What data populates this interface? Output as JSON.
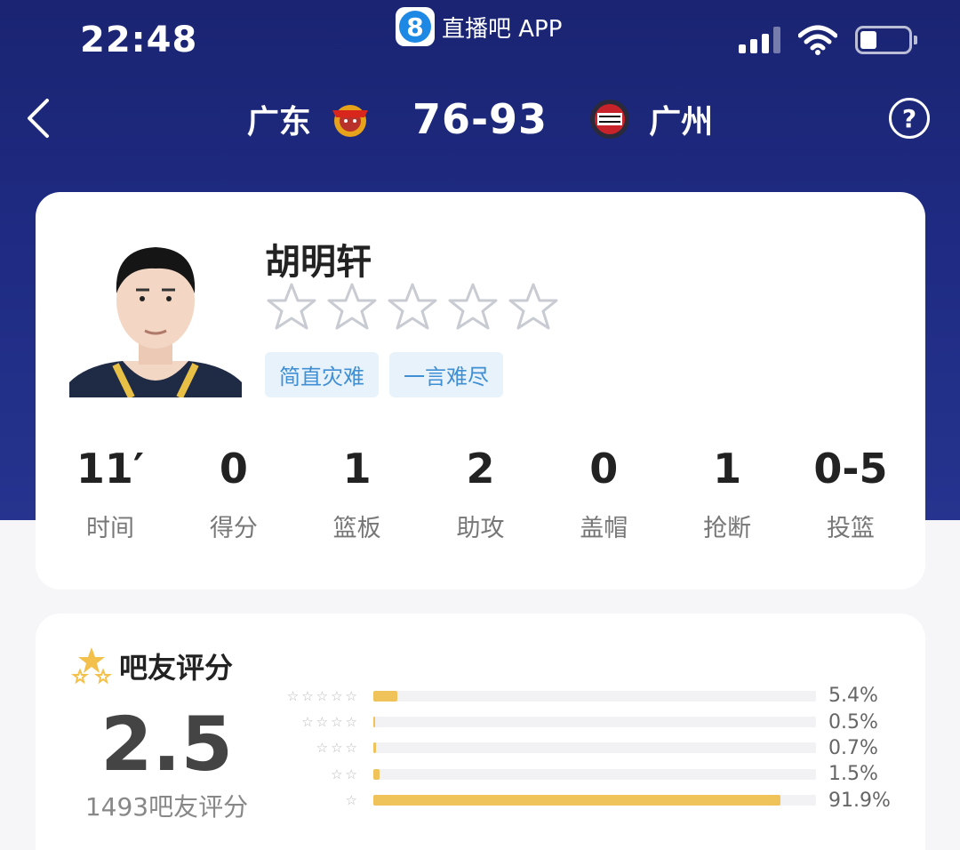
{
  "status_bar": {
    "time": "22:48",
    "app_logo_char": "8",
    "app_name": "直播吧 APP",
    "signal_icon": "signal-icon",
    "wifi_icon": "wifi-icon",
    "battery_icon": "battery-icon",
    "battery_level": 0.35
  },
  "match": {
    "home_team": "广东",
    "home_logo": "guangdong-tigers-logo",
    "score": "76-93",
    "away_team": "广州",
    "away_logo": "guangzhou-loong-lions-logo",
    "back_icon": "chevron-left-icon",
    "help_label": "?"
  },
  "player": {
    "name": "胡明轩",
    "avatar": "player-photo",
    "rating_stars": 0,
    "max_stars": 5,
    "tags": [
      "简直灾难",
      "一言难尽"
    ],
    "stats": [
      {
        "value": "11′",
        "label": "时间"
      },
      {
        "value": "0",
        "label": "得分"
      },
      {
        "value": "1",
        "label": "篮板"
      },
      {
        "value": "2",
        "label": "助攻"
      },
      {
        "value": "0",
        "label": "盖帽"
      },
      {
        "value": "1",
        "label": "抢断"
      },
      {
        "value": "0-5",
        "label": "投篮"
      }
    ]
  },
  "fan_rating": {
    "title": "吧友评分",
    "title_icon": "stars-icon",
    "score": "2.5",
    "count_text": "1493吧友评分",
    "distribution": [
      {
        "stars": 5,
        "percent": 5.4,
        "label": "5.4%"
      },
      {
        "stars": 4,
        "percent": 0.5,
        "label": "0.5%"
      },
      {
        "stars": 3,
        "percent": 0.7,
        "label": "0.7%"
      },
      {
        "stars": 2,
        "percent": 1.5,
        "label": "1.5%"
      },
      {
        "stars": 1,
        "percent": 91.9,
        "label": "91.9%"
      }
    ],
    "bar_color": "#f0c25a"
  }
}
